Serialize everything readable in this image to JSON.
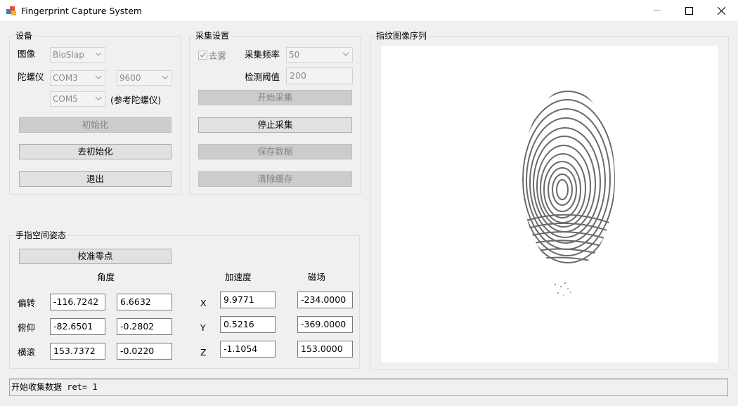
{
  "window": {
    "title": "Fingerprint Capture System",
    "minimize_icon": "minimize-icon",
    "maximize_icon": "maximize-icon",
    "close_icon": "close-icon"
  },
  "device": {
    "legend": "设备",
    "image_label": "图像",
    "image_value": "BioSlap",
    "gyro_label": "陀螺仪",
    "gyro_port": "COM3",
    "gyro_baud": "9600",
    "ref_port": "COM5",
    "ref_label": "(参考陀螺仪)",
    "init_button": "初始化",
    "deinit_button": "去初始化",
    "exit_button": "退出"
  },
  "capture": {
    "legend": "采集设置",
    "defog_label": "去雾",
    "defog_checked": true,
    "freq_label": "采集频率",
    "freq_value": "50",
    "threshold_label": "检测阈值",
    "threshold_value": "200",
    "start_button": "开始采集",
    "stop_button": "停止采集",
    "save_button": "保存数据",
    "clear_button": "清除缓存"
  },
  "sequence": {
    "legend": "指纹图像序列"
  },
  "posture": {
    "legend": "手指空间姿态",
    "calibrate_button": "校准零点",
    "angle_header": "角度",
    "accel_header": "加速度",
    "mag_header": "磁场",
    "rows": [
      {
        "name": "偏转",
        "angle1": "-116.7242",
        "angle2": "6.6632",
        "axis": "X",
        "accel": "9.9771",
        "mag": "-234.0000"
      },
      {
        "name": "俯仰",
        "angle1": "-82.6501",
        "angle2": "-0.2802",
        "axis": "Y",
        "accel": "0.5216",
        "mag": "-369.0000"
      },
      {
        "name": "横滚",
        "angle1": "153.7372",
        "angle2": "-0.0220",
        "axis": "Z",
        "accel": "-1.1054",
        "mag": "153.0000"
      }
    ]
  },
  "status": {
    "text": "开始收集数据  ret= 1"
  },
  "colors": {
    "disabled_text": "#838383",
    "window_bg": "#f0f0f0"
  }
}
